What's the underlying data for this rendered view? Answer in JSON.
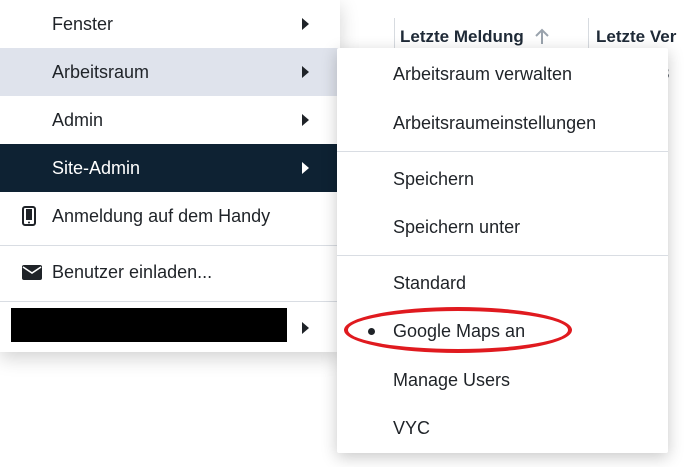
{
  "table_header": {
    "col1_label": "Letzte Meldung",
    "col2_label": "Letzte Ver",
    "row_partial": "3"
  },
  "main_menu": {
    "items": [
      {
        "label": "Fenster",
        "has_submenu": true,
        "state": "normal"
      },
      {
        "label": "Arbeitsraum",
        "has_submenu": true,
        "state": "hover"
      },
      {
        "label": "Admin",
        "has_submenu": true,
        "state": "normal"
      },
      {
        "label": "Site-Admin",
        "has_submenu": true,
        "state": "selected"
      },
      {
        "label": "Anmeldung auf dem Handy",
        "icon": "mobile-phone-icon",
        "has_submenu": false
      },
      {
        "label": "Benutzer einladen...",
        "icon": "envelope-icon",
        "has_submenu": false
      },
      {
        "label": "[redacted]",
        "has_submenu": true,
        "redacted": true
      }
    ]
  },
  "submenu": {
    "items": [
      {
        "label": "Arbeitsraum verwalten"
      },
      {
        "label": "Arbeitsraumeinstellungen"
      },
      {
        "label": "Speichern"
      },
      {
        "label": "Speichern unter"
      },
      {
        "label": "Standard"
      },
      {
        "label": "Google Maps an",
        "active": true
      },
      {
        "label": "Manage Users"
      },
      {
        "label": "VYC"
      }
    ]
  },
  "colors": {
    "hover_bg": "#dfe3ec",
    "selected_bg": "#0e2233",
    "annotation_red": "#e01a1f"
  }
}
